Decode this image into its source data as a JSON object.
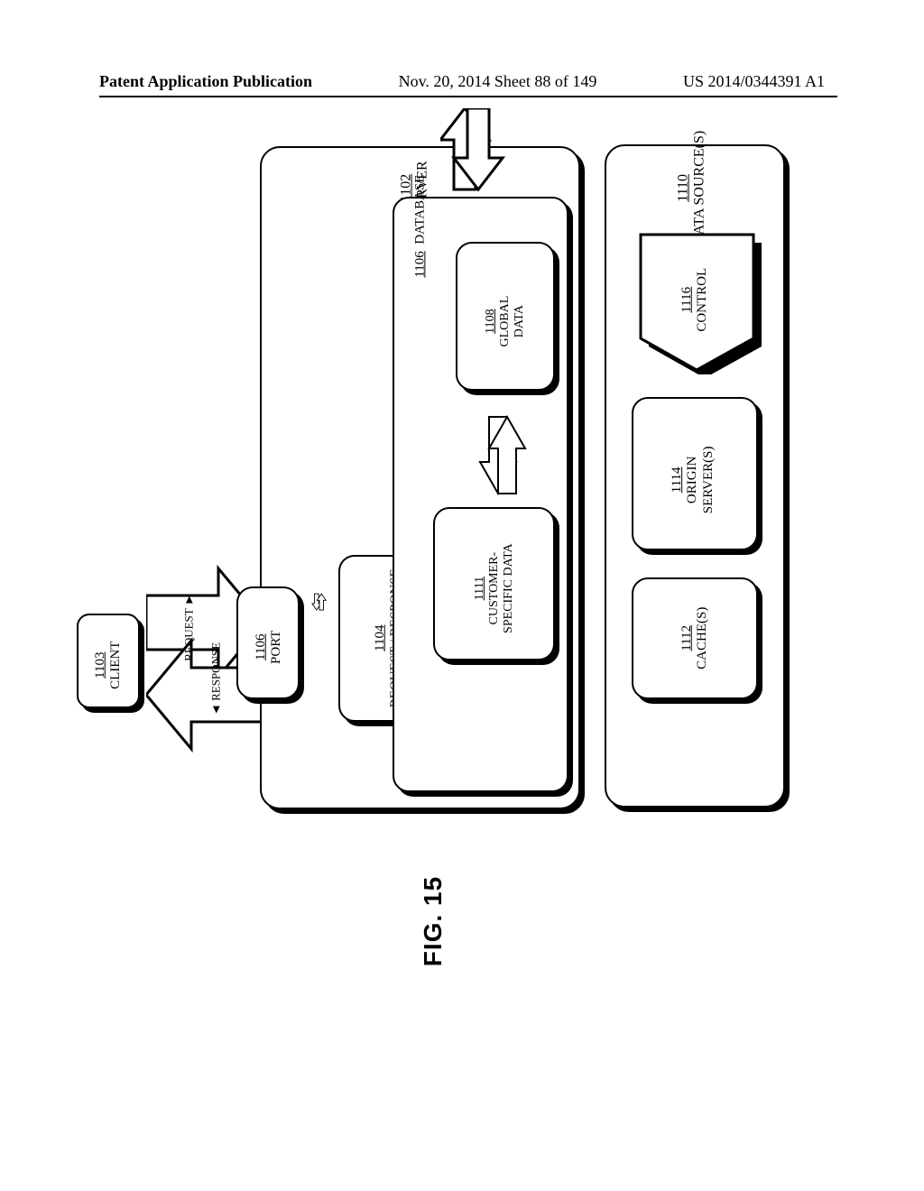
{
  "header": {
    "left": "Patent Application Publication",
    "mid": "Nov. 20, 2014  Sheet 88 of 149",
    "right": "US 2014/0344391 A1"
  },
  "figure_label": "FIG. 15",
  "blocks": {
    "client": {
      "ref": "1103",
      "label": "CLIENT"
    },
    "port": {
      "ref": "1106",
      "label": "PORT"
    },
    "server": {
      "ref": "1102",
      "label": "SERVER"
    },
    "reqresp": {
      "ref": "1104",
      "label": "REQUEST / RESPONSE"
    },
    "database": {
      "ref": "1106",
      "label": "DATABASE"
    },
    "custdata": {
      "ref": "1111",
      "label": "CUSTOMER-SPECIFIC DATA"
    },
    "globaldata": {
      "ref": "1108",
      "label": "GLOBAL DATA"
    },
    "datasources": {
      "ref": "1110",
      "label": "DATA SOURCE(S)"
    },
    "caches": {
      "ref": "1112",
      "label": "CACHE(S)"
    },
    "originservers": {
      "ref": "1114",
      "label": "ORIGIN SERVER(S)"
    },
    "control": {
      "ref": "1116",
      "label": "CONTROL"
    }
  },
  "arrows": {
    "request": "REQUEST",
    "response": "RESPONSE"
  }
}
